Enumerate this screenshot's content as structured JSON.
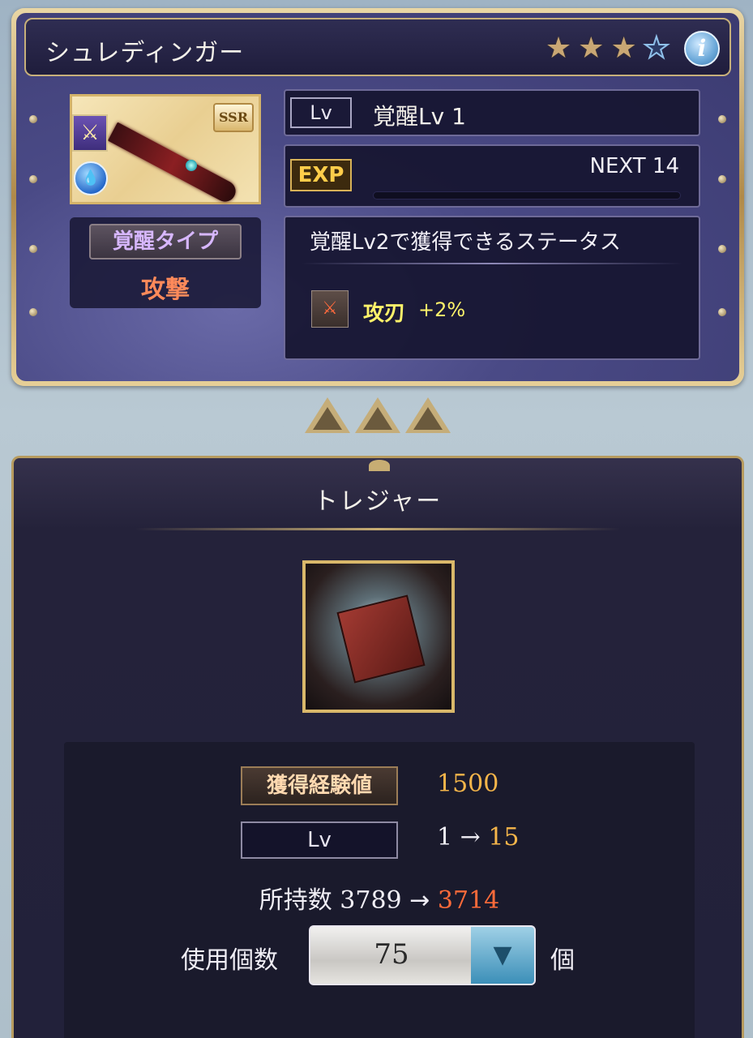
{
  "header": {
    "name": "シュレディンガー",
    "stars": [
      "filled",
      "filled",
      "filled",
      "empty"
    ],
    "info_icon": "i"
  },
  "weapon": {
    "rarity": "SSR",
    "type_icon": "crossed-swords-icon",
    "element_icon": "water-icon",
    "awakening_label": "覚醒タイプ",
    "awakening_value": "攻撃"
  },
  "level": {
    "tag": "Lv",
    "text": "覚醒Lv 1"
  },
  "exp": {
    "tag": "EXP",
    "next": "NEXT 14",
    "progress": 0
  },
  "status": {
    "title": "覚醒Lv2で獲得できるステータス",
    "icon": "attack-up-icon",
    "name": "攻刃",
    "value": "+2%"
  },
  "panel": {
    "title": "トレジャー",
    "exp_label": "獲得経験値",
    "exp_value": "1500",
    "lv_label": "Lv",
    "lv_from": "1",
    "lv_arrow": "→",
    "lv_to": "15",
    "owned_label": "所持数",
    "owned_from": "3789",
    "owned_arrow": "→",
    "owned_to": "3714",
    "use_label": "使用個数",
    "use_value": "75",
    "use_unit": "個"
  },
  "colors": {
    "accent_gold": "#c7ad73",
    "awakening_value": "#ff8a5a",
    "status_value": "#fff36a",
    "exp_value": "#f5b54a",
    "owned_after": "#ff6b3a"
  }
}
